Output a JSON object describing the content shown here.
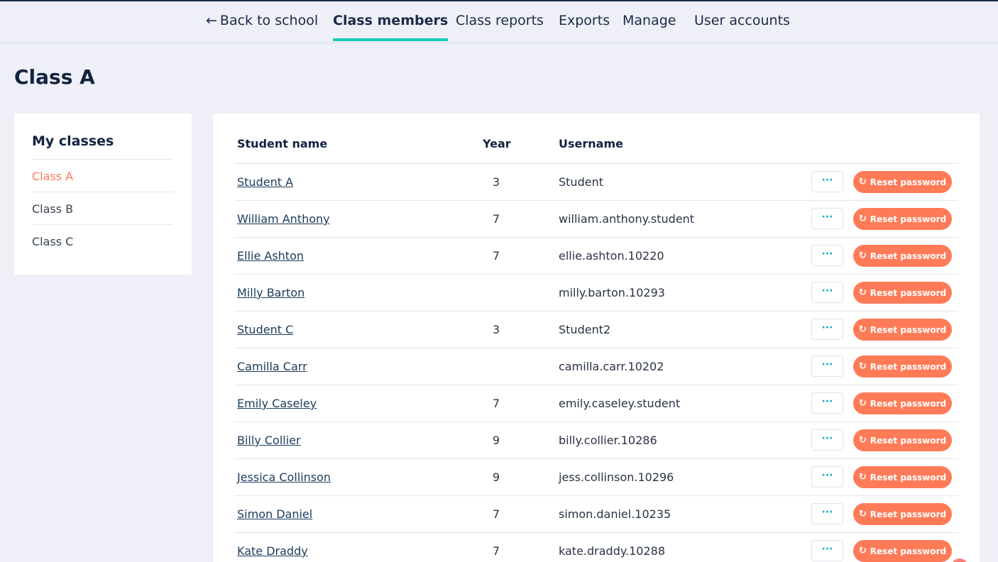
{
  "nav": {
    "back_arrow": "←",
    "back_label": "Back to school",
    "tabs": [
      {
        "label": "Class members"
      },
      {
        "label": "Class reports"
      },
      {
        "label": "Exports"
      },
      {
        "label": "Manage"
      },
      {
        "label": "User accounts"
      }
    ],
    "accent_color": "#17cdb9"
  },
  "page": {
    "title": "Class A"
  },
  "sidebar": {
    "title": "My classes",
    "items": [
      {
        "label": "Class A"
      },
      {
        "label": "Class B"
      },
      {
        "label": "Class C"
      }
    ]
  },
  "table": {
    "headers": {
      "name": "Student name",
      "year": "Year",
      "username": "Username"
    },
    "more_label": "···",
    "reset_icon": "↻",
    "reset_label": "Reset password",
    "rows": [
      {
        "name": "Student A",
        "year": "3",
        "username": "Student"
      },
      {
        "name": "William Anthony",
        "year": "7",
        "username": "william.anthony.student"
      },
      {
        "name": "Ellie Ashton",
        "year": "7",
        "username": "ellie.ashton.10220"
      },
      {
        "name": "Milly Barton",
        "year": "",
        "username": "milly.barton.10293"
      },
      {
        "name": "Student C",
        "year": "3",
        "username": "Student2"
      },
      {
        "name": "Camilla Carr",
        "year": "",
        "username": "camilla.carr.10202"
      },
      {
        "name": "Emily Caseley",
        "year": "7",
        "username": "emily.caseley.student"
      },
      {
        "name": "Billy Collier",
        "year": "9",
        "username": "billy.collier.10286"
      },
      {
        "name": "Jessica Collinson",
        "year": "9",
        "username": "jess.collinson.10296"
      },
      {
        "name": "Simon Daniel",
        "year": "7",
        "username": "simon.daniel.10235"
      },
      {
        "name": "Kate Draddy",
        "year": "7",
        "username": "kate.draddy.10288"
      }
    ]
  },
  "colors": {
    "reset_button": "#ff7b58",
    "active_sidebar": "#ff7a55"
  }
}
